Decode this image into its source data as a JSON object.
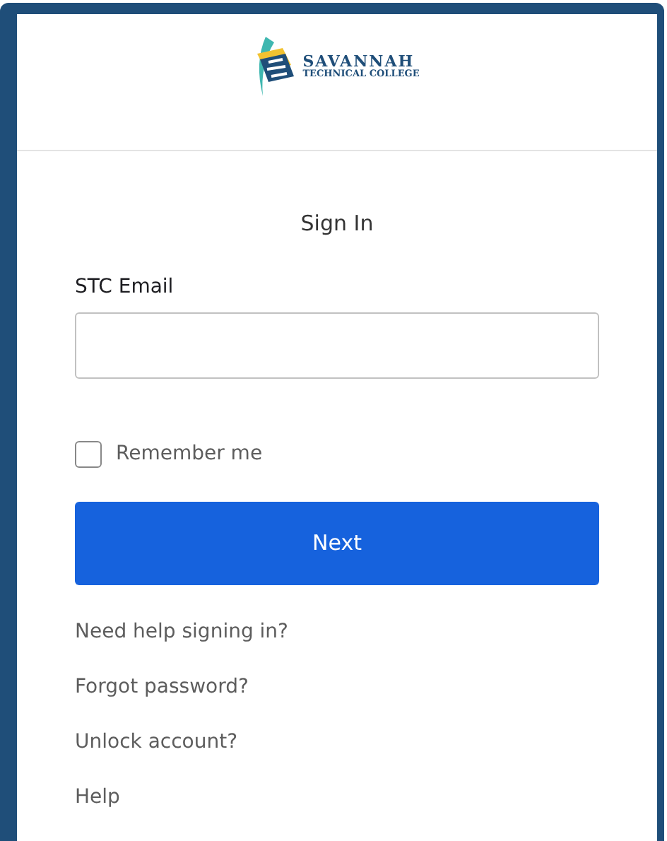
{
  "logo": {
    "name": "SAVANNAH",
    "subtitle": "TECHNICAL COLLEGE"
  },
  "title": "Sign In",
  "email": {
    "label": "STC Email"
  },
  "remember": {
    "label": "Remember me",
    "checked": false
  },
  "next_button": "Next",
  "links": [
    "Need help signing in?",
    "Forgot password?",
    "Unlock account?",
    "Help"
  ]
}
